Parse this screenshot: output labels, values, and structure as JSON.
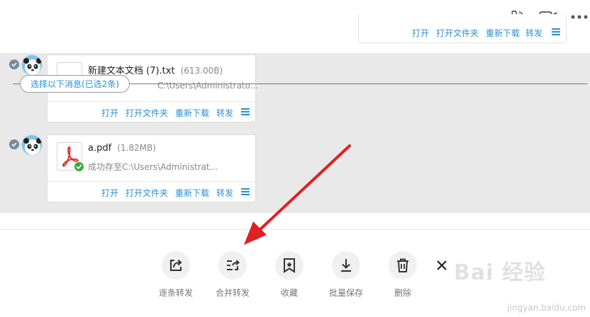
{
  "header": {
    "icons": [
      "phone-icon",
      "video-icon",
      "more-icon"
    ]
  },
  "top_card": {
    "actions": [
      "打开",
      "打开文件夹",
      "重新下载",
      "转发"
    ]
  },
  "messages": [
    {
      "file_name": "新建文本文档 (7).txt",
      "file_size": "(613.00B)",
      "path": "C:\\Users\\Administrato...",
      "actions": [
        "打开",
        "打开文件夹",
        "重新下载",
        "转发"
      ]
    },
    {
      "file_name": "a.pdf",
      "file_size": "(1.82MB)",
      "path": "成功存至C:\\Users\\Administrat...",
      "actions": [
        "打开",
        "打开文件夹",
        "重新下载",
        "转发"
      ]
    }
  ],
  "selection": {
    "label": "选择以下消息(已选2条)"
  },
  "toolbar": {
    "items": [
      {
        "label": "逐条转发",
        "icon": "share-icon"
      },
      {
        "label": "合并转发",
        "icon": "merge-forward-icon"
      },
      {
        "label": "收藏",
        "icon": "bookmark-icon"
      },
      {
        "label": "批量保存",
        "icon": "download-icon"
      },
      {
        "label": "删除",
        "icon": "trash-icon"
      }
    ],
    "close_icon": "close-icon"
  },
  "watermark": {
    "logo": "Bai 经验",
    "url": "jingyan.baidu.com"
  },
  "colors": {
    "accent": "#2a8fd6",
    "selected_bg": "#e9e9e9",
    "arrow": "#e02020"
  }
}
